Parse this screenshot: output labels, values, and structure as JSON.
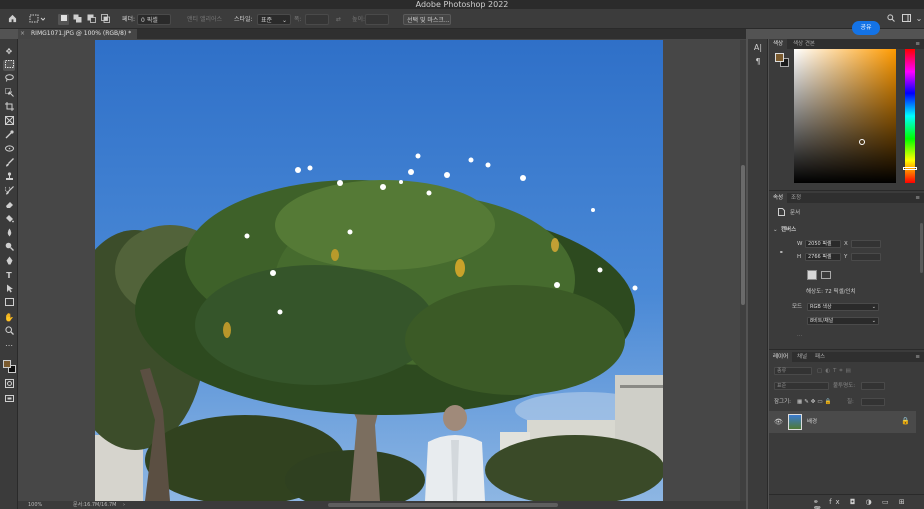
{
  "app": {
    "title": "Adobe Photoshop 2022"
  },
  "options_bar": {
    "feather_label": "페더:",
    "feather_value": "0 픽셀",
    "antialias_label": "앤티 앨리어스",
    "style_label": "스타일:",
    "style_value": "표준",
    "width_label": "폭:",
    "height_label": "높이:",
    "select_mask_button": "선택 및 마스크...",
    "share_button": "공유"
  },
  "document": {
    "tab_label": "RIMG1071.JPG @ 100% (RGB/8) *"
  },
  "status_bar": {
    "zoom": "100%",
    "doc_size": "문서:16.7M/16.7M"
  },
  "color_panel": {
    "tabs": [
      "색상",
      "색상 견본"
    ],
    "foreground_color": "#7a5a2e",
    "background_color": "#1a1a1a",
    "picker_hue": "#ff9a00"
  },
  "properties_panel": {
    "tabs": [
      "속성",
      "조정"
    ],
    "doc_label": "문서",
    "canvas_section": "캔버스",
    "w_label": "W",
    "w_value": "2050 픽셀",
    "h_label": "H",
    "h_value": "2766 픽셀",
    "x_label": "X",
    "y_label": "Y",
    "resolution": "해상도: 72 픽셀/인치",
    "mode_label": "모드",
    "mode_value": "RGB 색상",
    "depth_value": "8비트/채널"
  },
  "layers_panel": {
    "tabs": [
      "레이어",
      "채널",
      "패스"
    ],
    "kind_label": "종류",
    "blend_mode": "표준",
    "opacity_label": "불투명도:",
    "lock_label": "잠그기:",
    "fill_label": "칠:",
    "layer_name": "배경"
  }
}
